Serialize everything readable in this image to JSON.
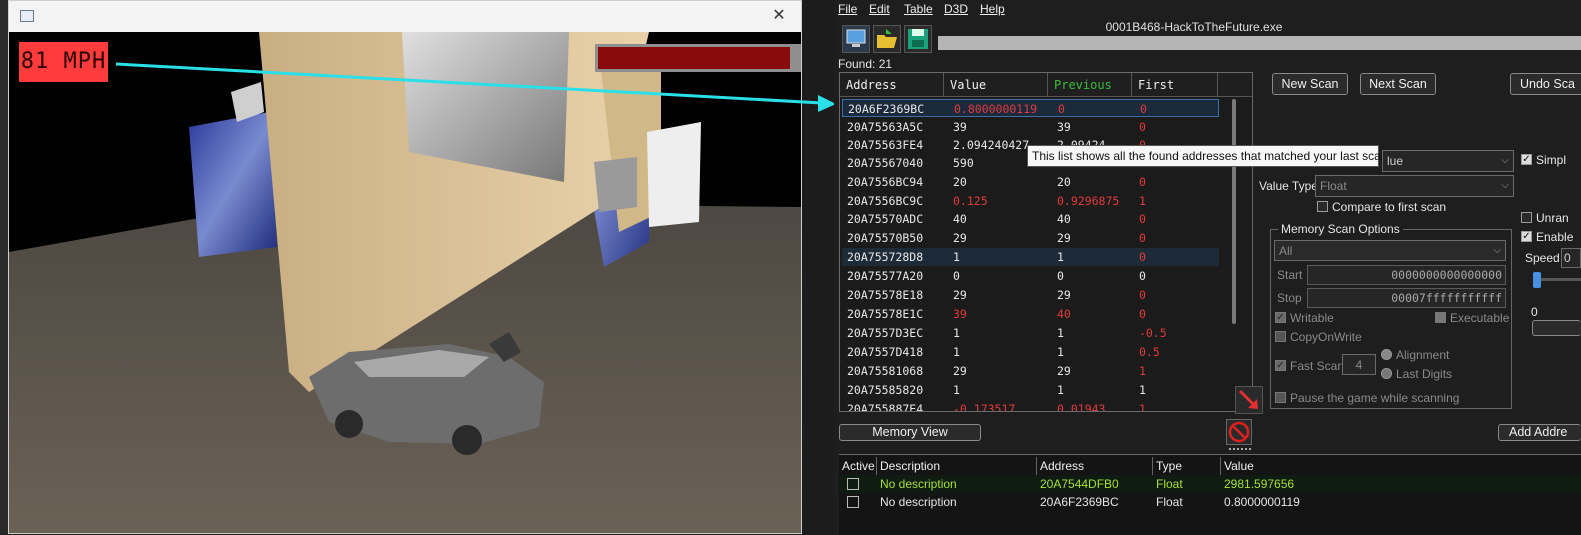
{
  "game": {
    "speed_text": "81 MPH",
    "health_fraction": 0.93,
    "close_glyph": "✕"
  },
  "ce": {
    "menu": [
      "File",
      "Edit",
      "Table",
      "D3D",
      "Help"
    ],
    "title": "0001B468-HackToTheFuture.exe",
    "found_label": "Found: 21",
    "columns": {
      "address": "Address",
      "value": "Value",
      "previous": "Previous",
      "first": "First"
    },
    "rows": [
      {
        "address": "20A6F2369BC",
        "value": "0.8000000119",
        "previous": "0",
        "first": "0"
      },
      {
        "address": "20A75563A5C",
        "value": "39",
        "previous": "39",
        "first": "0"
      },
      {
        "address": "20A75563FE4",
        "value": "2.094240427",
        "previous": "2.09424",
        "first": "0"
      },
      {
        "address": "20A75567040",
        "value": "590",
        "previous": "590",
        "first": "0"
      },
      {
        "address": "20A7556BC94",
        "value": "20",
        "previous": "20",
        "first": "0"
      },
      {
        "address": "20A7556BC9C",
        "value": "0.125",
        "previous": "0.9296875",
        "first": "1"
      },
      {
        "address": "20A75570ADC",
        "value": "40",
        "previous": "40",
        "first": "0"
      },
      {
        "address": "20A75570B50",
        "value": "29",
        "previous": "29",
        "first": "0"
      },
      {
        "address": "20A755728D8",
        "value": "1",
        "previous": "1",
        "first": "0"
      },
      {
        "address": "20A75577A20",
        "value": "0",
        "previous": "0",
        "first": "0"
      },
      {
        "address": "20A75578E18",
        "value": "29",
        "previous": "29",
        "first": "0"
      },
      {
        "address": "20A75578E1C",
        "value": "39",
        "previous": "40",
        "first": "0"
      },
      {
        "address": "20A7557D3EC",
        "value": "1",
        "previous": "1",
        "first": "-0.5"
      },
      {
        "address": "20A7557D418",
        "value": "1",
        "previous": "1",
        "first": "0.5"
      },
      {
        "address": "20A75581068",
        "value": "29",
        "previous": "29",
        "first": "1"
      },
      {
        "address": "20A75585820",
        "value": "1",
        "previous": "1",
        "first": "1"
      },
      {
        "address": "20A755887E4",
        "value": "-0.173517...",
        "previous": "0.01943...",
        "first": "1"
      }
    ],
    "tooltip": "This list shows all the found addresses that matched your last scan",
    "buttons": {
      "new_scan": "New Scan",
      "next_scan": "Next Scan",
      "undo_scan": "Undo Sca",
      "memory_view": "Memory View",
      "add_address": "Add Addre"
    },
    "scan_type_value": "lue",
    "value_type_label": "Value Type",
    "value_type_value": "Float",
    "compare_first_label": "Compare to first scan",
    "simple_label": "Simpl",
    "unrand_label": "Unran",
    "enable_label": "Enable",
    "speed_label": "Speed",
    "speed_value": "0",
    "speed_min": "0",
    "memory_scan_options": {
      "title": "Memory Scan Options",
      "region": "All",
      "start_label": "Start",
      "start_value": "0000000000000000",
      "stop_label": "Stop",
      "stop_value": "00007fffffffffff",
      "writable": "Writable",
      "executable": "Executable",
      "copy_on_write": "CopyOnWrite",
      "fast_scan": "Fast Scan",
      "fast_scan_value": "4",
      "alignment": "Alignment",
      "last_digits": "Last Digits",
      "pause": "Pause the game while scanning"
    },
    "address_list": {
      "headers": {
        "active": "Active",
        "description": "Description",
        "address": "Address",
        "type": "Type",
        "value": "Value"
      },
      "rows": [
        {
          "description": "No description",
          "address": "20A7544DFB0",
          "type": "Float",
          "value": "2981.597656"
        },
        {
          "description": "No description",
          "address": "20A6F2369BC",
          "type": "Float",
          "value": "0.8000000119"
        }
      ]
    }
  }
}
